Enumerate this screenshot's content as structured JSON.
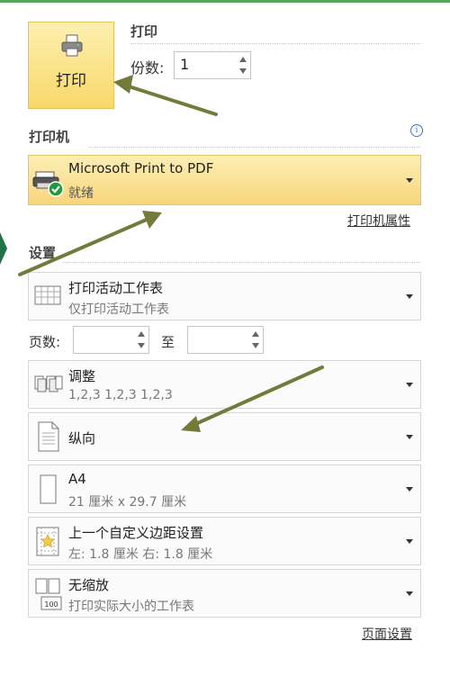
{
  "print_section": {
    "button_label": "打印",
    "header": "打印",
    "copies_label": "份数:",
    "copies_value": "1"
  },
  "printer_section": {
    "header": "打印机",
    "printer_name": "Microsoft Print to PDF",
    "printer_status": "就绪",
    "properties_link": "打印机属性"
  },
  "settings_section": {
    "header": "设置",
    "pages_label": "页数:",
    "pages_to_label": "至",
    "pages_from_value": "",
    "pages_to_value": "",
    "options": [
      {
        "title": "打印活动工作表",
        "subtitle": "仅打印活动工作表",
        "icon": "sheet-icon"
      },
      {
        "title": "调整",
        "subtitle": "1,2,3    1,2,3    1,2,3",
        "icon": "collate-icon"
      },
      {
        "title": "纵向",
        "subtitle": "",
        "icon": "portrait-icon"
      },
      {
        "title": "A4",
        "subtitle": "21 厘米 x 29.7 厘米",
        "icon": "paper-size-icon"
      },
      {
        "title": "上一个自定义边距设置",
        "subtitle": "左:  1.8 厘米     右:  1.8 厘米",
        "icon": "margins-icon"
      },
      {
        "title": "无缩放",
        "subtitle": "打印实际大小的工作表",
        "icon": "scaling-icon"
      }
    ],
    "page_setup_link": "页面设置"
  },
  "colors": {
    "accent_yellow": "#f8d86a",
    "arrow": "#737a3a",
    "excel_green": "#217346"
  }
}
